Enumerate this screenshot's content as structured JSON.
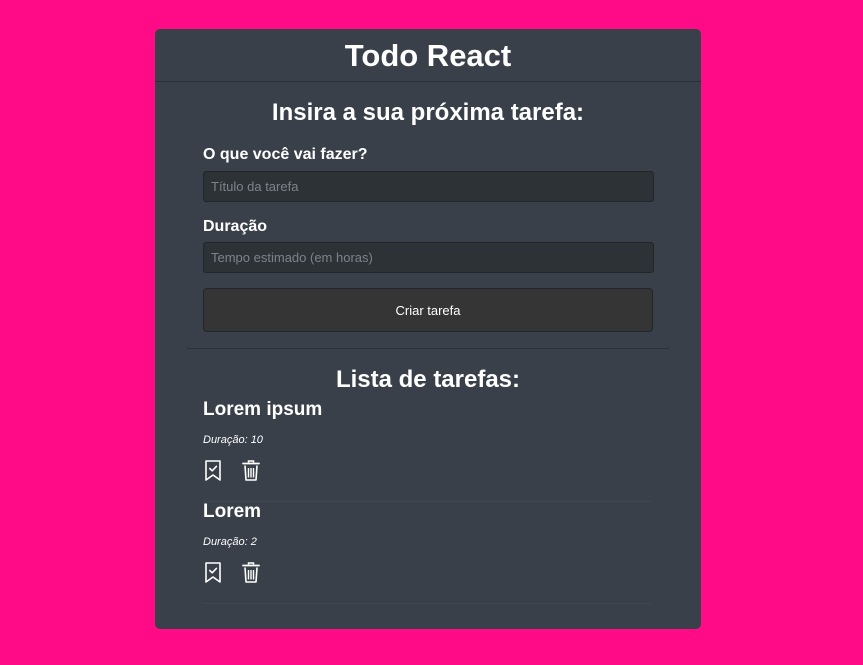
{
  "app": {
    "title": "Todo React"
  },
  "form": {
    "heading": "Insira a sua próxima tarefa:",
    "title_label": "O que você vai fazer?",
    "title_placeholder": "Título da tarefa",
    "title_value": "",
    "duration_label": "Duração",
    "duration_placeholder": "Tempo estimado (em horas)",
    "duration_value": "",
    "submit_label": "Criar tarefa"
  },
  "list": {
    "heading": "Lista de tarefas:",
    "tasks": [
      {
        "title": "Lorem ipsum",
        "duration": "Duração: 10",
        "icons": [
          "bookmark-check-icon",
          "trash-icon"
        ]
      },
      {
        "title": "Lorem",
        "duration": "Duração: 2",
        "icons": [
          "bookmark-check-icon",
          "trash-icon"
        ]
      }
    ]
  },
  "colors": {
    "background": "#ff0a87",
    "card": "#394049",
    "input": "#2d3237",
    "button": "#353535"
  }
}
